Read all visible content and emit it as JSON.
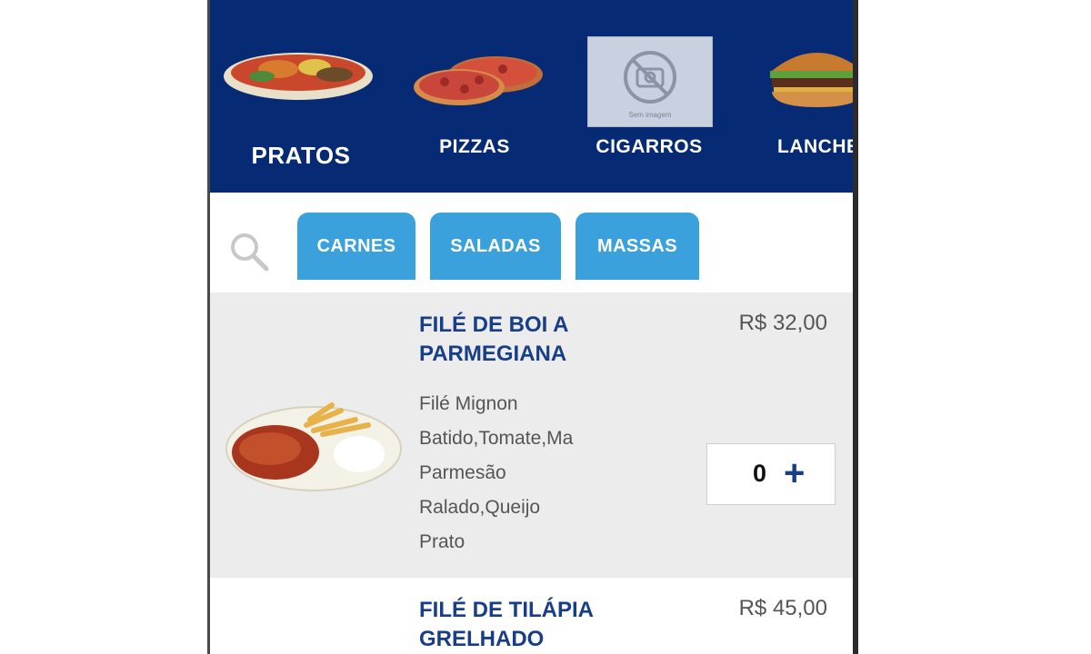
{
  "categories": [
    {
      "label": "PRATOS",
      "active": true
    },
    {
      "label": "PIZZAS",
      "active": false
    },
    {
      "label": "CIGARROS",
      "active": false
    },
    {
      "label": "LANCHE",
      "active": false
    }
  ],
  "no_image_caption": "Sem imagem",
  "filters": [
    "CARNES",
    "SALADAS",
    "MASSAS"
  ],
  "products": [
    {
      "name": "FILÉ DE BOI A PARMEGIANA",
      "price": "R$ 32,00",
      "description": [
        "Filé Mignon",
        "Batido,Tomate,Ma",
        "Parmesão",
        "Ralado,Queijo",
        "Prato"
      ],
      "quantity": "0"
    },
    {
      "name": "FILÉ DE TILÁPIA GRELHADO",
      "price": "R$ 45,00"
    }
  ],
  "colors": {
    "header": "#062a73",
    "chip": "#3aa1dc",
    "title": "#173e86"
  }
}
